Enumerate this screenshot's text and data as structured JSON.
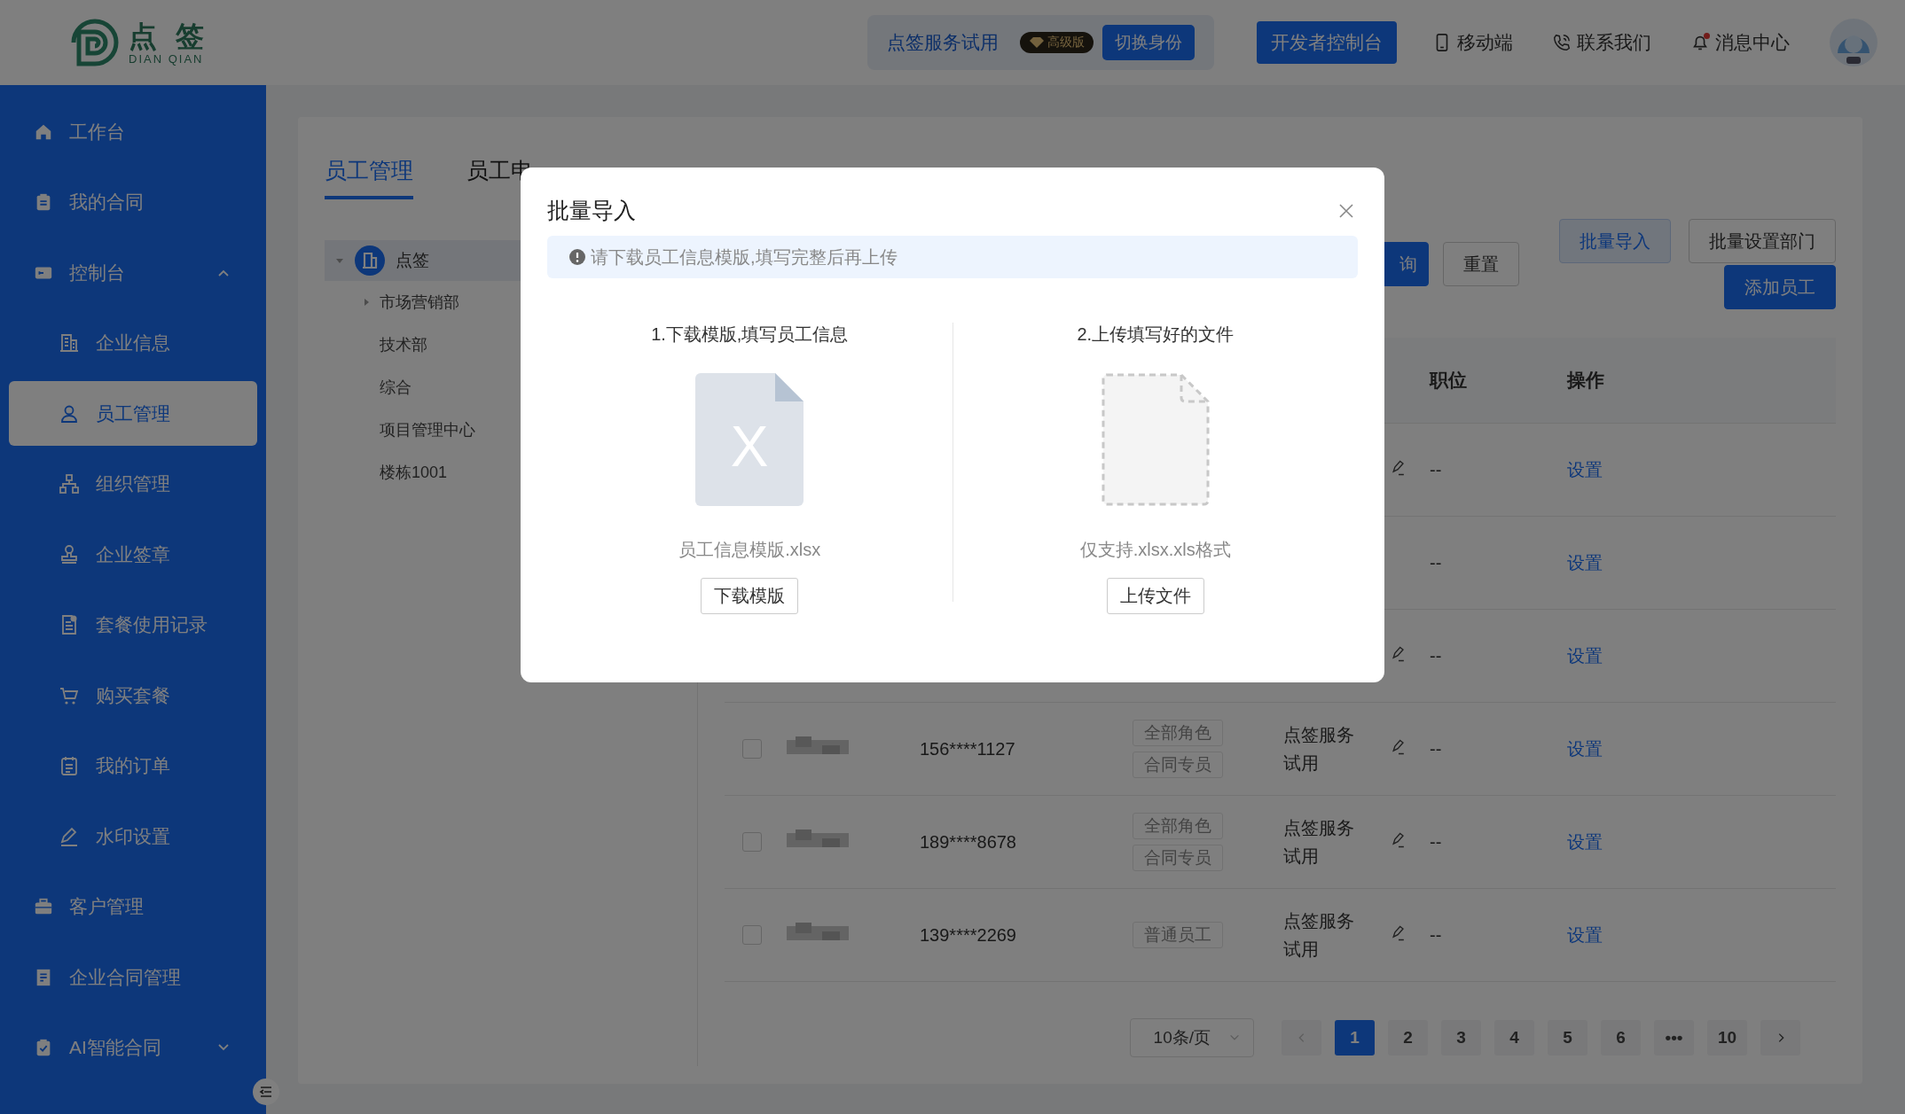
{
  "header": {
    "logo": {
      "title": "点 签",
      "subtitle": "DIAN QIAN"
    },
    "account": {
      "name": "点签服务试用",
      "badge": "高级版",
      "switch_button": "切换身份"
    },
    "dev_button": "开发者控制台",
    "links": [
      {
        "kind": "mobile",
        "label": "移动端",
        "dot": false
      },
      {
        "kind": "contact",
        "label": "联系我们",
        "dot": false
      },
      {
        "kind": "bell",
        "label": "消息中心",
        "dot": true
      }
    ]
  },
  "sidebar": {
    "items": [
      {
        "kind": "home",
        "label": "工作台",
        "selected": false
      },
      {
        "kind": "clipboard",
        "label": "我的合同",
        "selected": false
      },
      {
        "kind": "console",
        "label": "控制台",
        "selected": false,
        "expanded": true,
        "children": [
          {
            "kind": "building",
            "label": "企业信息",
            "selected": false
          },
          {
            "kind": "person",
            "label": "员工管理",
            "selected": true
          },
          {
            "kind": "org",
            "label": "组织管理",
            "selected": false
          },
          {
            "kind": "stamp",
            "label": "企业签章",
            "selected": false
          },
          {
            "kind": "record",
            "label": "套餐使用记录",
            "selected": false
          },
          {
            "kind": "cart",
            "label": "购买套餐",
            "selected": false
          },
          {
            "kind": "list",
            "label": "我的订单",
            "selected": false
          },
          {
            "kind": "pen",
            "label": "水印设置",
            "selected": false
          }
        ]
      },
      {
        "kind": "briefcase",
        "label": "客户管理",
        "selected": false
      },
      {
        "kind": "doc",
        "label": "企业合同管理",
        "selected": false
      },
      {
        "kind": "check",
        "label": "AI智能合同",
        "selected": false,
        "expanded": false
      }
    ]
  },
  "tabs": [
    {
      "label": "员工管理",
      "selected": true
    },
    {
      "label": "员工申",
      "selected": false
    }
  ],
  "tree": {
    "label": "点签",
    "expanded": true,
    "selected": true,
    "children": [
      {
        "label": "市场营销部",
        "expandable": true
      },
      {
        "label": "技术部",
        "expandable": false
      },
      {
        "label": "综合",
        "expandable": false
      },
      {
        "label": "项目管理中心",
        "expandable": false
      },
      {
        "label": "楼栋1001",
        "expandable": false
      }
    ]
  },
  "filter_buttons": [
    {
      "kind": "primary",
      "label": "询"
    },
    {
      "kind": "default",
      "label": "重置"
    }
  ],
  "action_buttons": [
    {
      "kind": "light",
      "label": "批量导入"
    },
    {
      "kind": "default",
      "label": "批量设置部门"
    },
    {
      "kind": "primary",
      "label": "添加员工"
    }
  ],
  "table": {
    "columns": [
      {
        "label": "职位"
      },
      {
        "label": "操作"
      }
    ],
    "rows": [
      {
        "editable": true,
        "position": "--",
        "action": "设置"
      },
      {
        "editable": false,
        "position": "--",
        "action": "设置"
      },
      {
        "editable": true,
        "position": "--",
        "action": "设置"
      },
      {
        "checked": false,
        "phone": "156****1127",
        "roles": [
          "全部角色",
          "合同专员"
        ],
        "company": "点签服务试用",
        "editable": true,
        "position": "--",
        "action": "设置"
      },
      {
        "checked": false,
        "phone": "189****8678",
        "roles": [
          "全部角色",
          "合同专员"
        ],
        "company": "点签服务试用",
        "editable": true,
        "position": "--",
        "action": "设置"
      },
      {
        "checked": false,
        "phone": "139****2269",
        "roles": [
          "普通员工"
        ],
        "company": "点签服务试用",
        "editable": true,
        "position": "--",
        "action": "设置"
      }
    ]
  },
  "pagination": {
    "page_size": "10条/页",
    "pages": [
      {
        "label": "1",
        "selected": true
      },
      {
        "label": "2",
        "selected": false
      },
      {
        "label": "3",
        "selected": false
      },
      {
        "label": "4",
        "selected": false
      },
      {
        "label": "5",
        "selected": false
      },
      {
        "label": "6",
        "selected": false
      },
      {
        "label": "•••",
        "selected": false
      },
      {
        "label": "10",
        "selected": false
      }
    ]
  },
  "dialog": {
    "title": "批量导入",
    "notice": "请下载员工信息模版,填写完整后再上传",
    "steps": [
      {
        "kind": "template",
        "title": "1.下载模版,填写员工信息",
        "icon_letter": "X",
        "caption": "员工信息模版.xlsx",
        "button": "下载模版"
      },
      {
        "kind": "upload",
        "title": "2.上传填写好的文件",
        "caption": "仅支持.xlsx.xls格式",
        "button": "上传文件"
      }
    ]
  }
}
